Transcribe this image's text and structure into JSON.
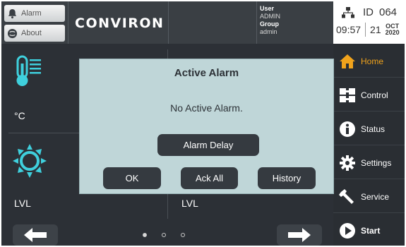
{
  "topbar": {
    "alarm_label": "Alarm",
    "about_label": "About",
    "brand": "CONVIRON",
    "user_key": "User",
    "user_value": "ADMIN",
    "group_key": "Group",
    "group_value": "admin",
    "id_label": "ID",
    "id_value": "064",
    "time": "09:57",
    "day": "21",
    "month": "OCT",
    "year": "2020"
  },
  "sidebar": {
    "items": [
      {
        "label": "Home",
        "icon": "home-icon"
      },
      {
        "label": "Control",
        "icon": "control-icon"
      },
      {
        "label": "Status",
        "icon": "info-icon"
      },
      {
        "label": "Settings",
        "icon": "gear-icon"
      },
      {
        "label": "Service",
        "icon": "wrench-icon"
      },
      {
        "label": "Start",
        "icon": "play-icon"
      }
    ]
  },
  "main": {
    "temp_unit": "°C",
    "light_unit_left": "LVL",
    "light_unit_right": "LVL"
  },
  "pager": {
    "pages": 3,
    "active": 0
  },
  "modal": {
    "title": "Active Alarm",
    "message": "No Active Alarm.",
    "alarm_delay_label": "Alarm Delay",
    "ok_label": "OK",
    "ack_all_label": "Ack All",
    "history_label": "History"
  },
  "colors": {
    "accent": "#f0a31c",
    "teal": "#3fd0dd",
    "modal_bg": "#bfd6d8",
    "button_dark": "#353a40"
  }
}
